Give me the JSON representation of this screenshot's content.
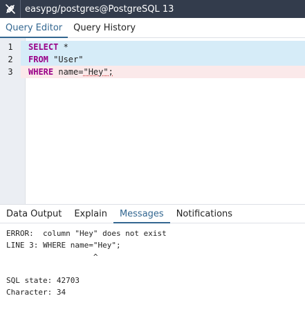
{
  "window": {
    "title": "easypg/postgres@PostgreSQL 13",
    "icon": "disconnect-plug-icon"
  },
  "query_tabs": [
    {
      "label": "Query Editor",
      "active": true
    },
    {
      "label": "Query History",
      "active": false
    }
  ],
  "editor": {
    "lines": [
      {
        "number": "1",
        "keyword": "SELECT",
        "rest": " *"
      },
      {
        "number": "2",
        "keyword": "FROM",
        "rest": " \"User\""
      },
      {
        "number": "3",
        "keyword": "WHERE",
        "rest_pre": " name=",
        "error_text": "\"Hey\";"
      }
    ]
  },
  "result_tabs": [
    {
      "label": "Data Output",
      "active": false
    },
    {
      "label": "Explain",
      "active": false
    },
    {
      "label": "Messages",
      "active": true
    },
    {
      "label": "Notifications",
      "active": false
    }
  ],
  "messages": {
    "lines": [
      "ERROR:  column \"Hey\" does not exist",
      "LINE 3: WHERE name=\"Hey\";",
      "                   ^",
      "",
      "SQL state: 42703",
      "Character: 34"
    ]
  },
  "colors": {
    "titlebar": "#333c4c",
    "accent": "#326690",
    "keyword": "#990088",
    "selected_line": "#d6ecf8",
    "error_line": "#fbe9ea"
  }
}
